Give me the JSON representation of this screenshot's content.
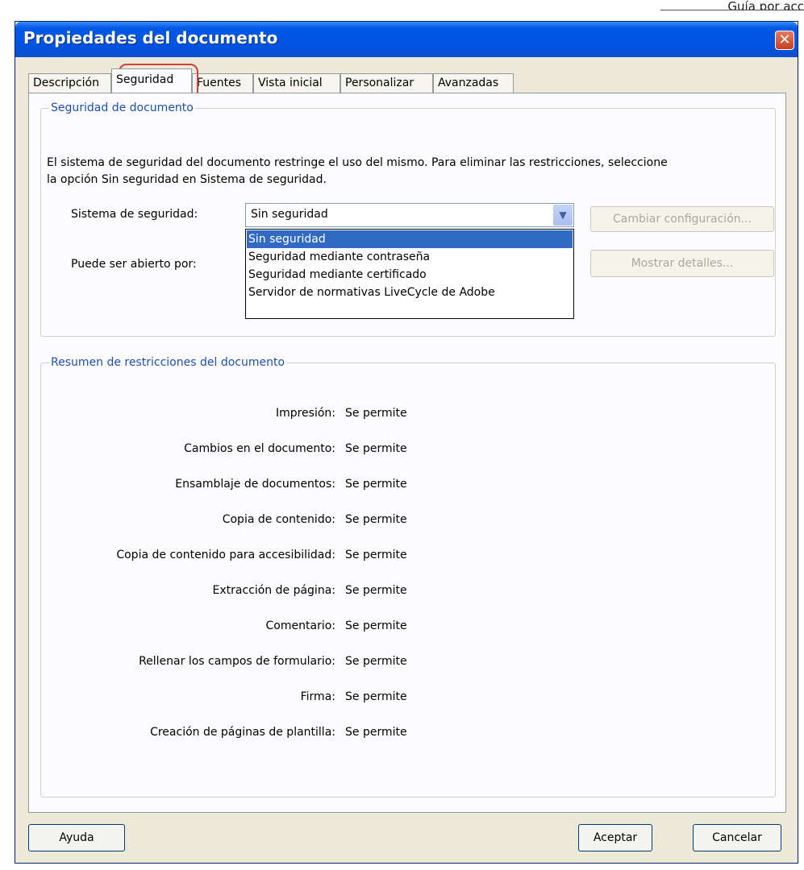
{
  "page_header": "Guía por acc",
  "dialog": {
    "title": "Propiedades del documento",
    "close_glyph": "✕",
    "tabs": [
      "Descripción",
      "Seguridad",
      "Fuentes",
      "Vista inicial",
      "Personalizar",
      "Avanzadas"
    ],
    "active_tab": "Seguridad"
  },
  "security": {
    "group_label": "Seguridad de documento",
    "description_line1": "El sistema de seguridad del documento restringe el uso del mismo. Para eliminar las restricciones, seleccione",
    "description_line2": "la opción Sin seguridad en Sistema de seguridad.",
    "system_label": "Sistema de seguridad:",
    "system_value": "Sin seguridad",
    "dropdown_arrow": "▼",
    "dropdown_options": [
      "Sin seguridad",
      "Seguridad mediante contraseña",
      "Seguridad mediante certificado",
      "Servidor de normativas LiveCycle de Adobe"
    ],
    "dropdown_selected": "Sin seguridad",
    "open_by_label": "Puede ser abierto por:",
    "change_config_button": "Cambiar configuración...",
    "show_details_button": "Mostrar detalles..."
  },
  "restrictions": {
    "group_label": "Resumen de restricciones del documento",
    "items": [
      {
        "label": "Impresión:",
        "value": "Se permite"
      },
      {
        "label": "Cambios en el documento:",
        "value": "Se permite"
      },
      {
        "label": "Ensamblaje de documentos:",
        "value": "Se permite"
      },
      {
        "label": "Copia de contenido:",
        "value": "Se permite"
      },
      {
        "label": "Copia de contenido para accesibilidad:",
        "value": "Se permite"
      },
      {
        "label": "Extracción de página:",
        "value": "Se permite"
      },
      {
        "label": "Comentario:",
        "value": "Se permite"
      },
      {
        "label": "Rellenar los campos de formulario:",
        "value": "Se permite"
      },
      {
        "label": "Firma:",
        "value": "Se permite"
      },
      {
        "label": "Creación de páginas de plantilla:",
        "value": "Se permite"
      }
    ]
  },
  "footer": {
    "help_button": "Ayuda",
    "accept_button": "Aceptar",
    "cancel_button": "Cancelar"
  },
  "colors": {
    "title_bar": "#0054E3",
    "group_label": "#1F4FB5",
    "highlight_selected": "#316AC5",
    "annotation_red": "#D03E3E"
  }
}
